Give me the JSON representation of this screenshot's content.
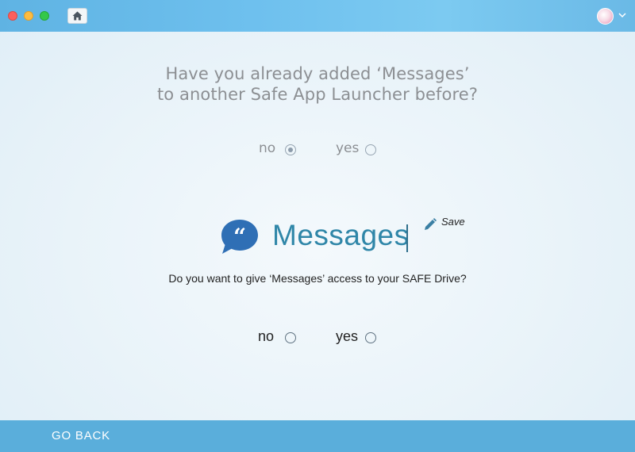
{
  "window": {
    "controls": [
      "close",
      "minimize",
      "maximize"
    ],
    "home_icon": "home-icon",
    "avatar_icon": "user-avatar",
    "avatar_menu_icon": "chevron-down-icon"
  },
  "question1": {
    "line1": "Have you already added ‘Messages’",
    "line2": "to another Safe App Launcher before?",
    "options": [
      {
        "label": "no",
        "checked": true
      },
      {
        "label": "yes",
        "checked": false
      }
    ]
  },
  "app": {
    "icon": "quote-bubble-icon",
    "name": "Messages",
    "edit_icon": "pencil-icon",
    "save_label": "Save"
  },
  "question2": {
    "text": "Do you want to give ‘Messages’ access to your SAFE Drive?",
    "options": [
      {
        "label": "no",
        "checked": false
      },
      {
        "label": "yes",
        "checked": false
      }
    ]
  },
  "footer": {
    "go_back_label": "GO BACK"
  },
  "colors": {
    "titlebar": "#6ec0ee",
    "footer": "#5aaedb",
    "accent": "#2f86a8",
    "app_icon": "#2f6fb5"
  }
}
